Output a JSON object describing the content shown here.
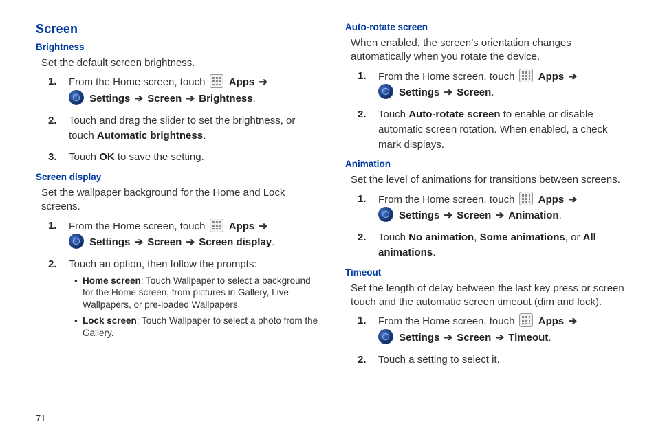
{
  "page_number": "71",
  "left": {
    "heading_main": "Screen",
    "brightness": {
      "heading": "Brightness",
      "intro": "Set the default screen brightness.",
      "step1_prefix": "From the Home screen, touch ",
      "apps": "Apps",
      "settings": "Settings",
      "screen": "Screen",
      "brightness": "Brightness",
      "step2_a": "Touch and drag the slider to set the brightness, or touch ",
      "step2_b": "Automatic brightness",
      "step3_a": "Touch ",
      "step3_b": "OK",
      "step3_c": " to save the setting."
    },
    "display": {
      "heading": "Screen display",
      "intro": "Set the wallpaper background for the Home and Lock screens.",
      "step1_prefix": "From the Home screen, touch ",
      "apps": "Apps",
      "settings": "Settings",
      "screen": "Screen",
      "screendisplay": "Screen display",
      "step2": "Touch an option, then follow the prompts:",
      "bullet1_b": "Home screen",
      "bullet1_t": ": Touch Wallpaper to select a background for the Home screen, from pictures in Gallery, Live Wallpapers, or pre-loaded Wallpapers.",
      "bullet2_b": "Lock screen",
      "bullet2_t": ": Touch Wallpaper to select a photo from the Gallery."
    }
  },
  "right": {
    "autorotate": {
      "heading": "Auto-rotate screen",
      "intro": "When enabled, the screen’s orientation changes automatically when you rotate the device.",
      "step1_prefix": "From the Home screen, touch ",
      "apps": "Apps",
      "settings": "Settings",
      "screen": "Screen",
      "step2_a": "Touch ",
      "step2_b": "Auto-rotate screen",
      "step2_c": " to enable or disable automatic screen rotation. When enabled, a check mark displays."
    },
    "animation": {
      "heading": "Animation",
      "intro": "Set the level of animations for transitions between screens.",
      "step1_prefix": "From the Home screen, touch ",
      "apps": "Apps",
      "settings": "Settings",
      "screen": "Screen",
      "animation": "Animation",
      "step2_a": "Touch ",
      "step2_b1": "No animation",
      "step2_sep1": ", ",
      "step2_b2": "Some animations",
      "step2_sep2": ", or ",
      "step2_b3": "All animations",
      "step2_end": "."
    },
    "timeout": {
      "heading": "Timeout",
      "intro": "Set the length of delay between the last key press or screen touch and the automatic screen timeout (dim and lock).",
      "step1_prefix": "From the Home screen, touch ",
      "apps": "Apps",
      "settings": "Settings",
      "screen": "Screen",
      "timeout": "Timeout",
      "step2": "Touch a setting to select it."
    }
  }
}
